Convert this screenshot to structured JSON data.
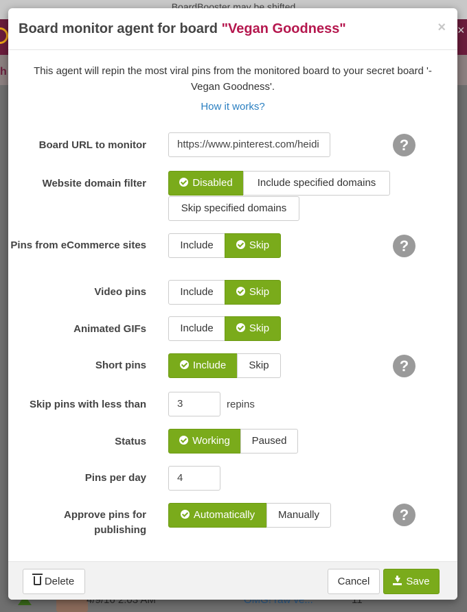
{
  "background": {
    "notice": "BoardBooster may be shifted",
    "header_letter": "h",
    "row_date": "4/9/16 2:03 AM",
    "row_link": "OMG! raw ve...",
    "row_count": "11"
  },
  "modal": {
    "title_prefix": "Board monitor agent for board",
    "board_name": "\"Vegan Goodness\"",
    "close_glyph": "×",
    "intro": "This agent will repin the most viral pins from the monitored board to your secret board '-Vegan Goodness'.",
    "how_link": "How it works?",
    "help_glyph": "?"
  },
  "fields": {
    "board_url": {
      "label": "Board URL to monitor",
      "value": "https://www.pinterest.com/heidi"
    },
    "domain_filter": {
      "label": "Website domain filter",
      "options": [
        "Disabled",
        "Include specified domains",
        "Skip specified domains"
      ],
      "selected": "Disabled"
    },
    "ecommerce": {
      "label": "Pins from eCommerce sites",
      "options": [
        "Include",
        "Skip"
      ],
      "selected": "Skip"
    },
    "video": {
      "label": "Video pins",
      "options": [
        "Include",
        "Skip"
      ],
      "selected": "Skip"
    },
    "gifs": {
      "label": "Animated GIFs",
      "options": [
        "Include",
        "Skip"
      ],
      "selected": "Skip"
    },
    "short": {
      "label": "Short pins",
      "options": [
        "Include",
        "Skip"
      ],
      "selected": "Include"
    },
    "min_repins": {
      "label": "Skip pins with less than",
      "value": "3",
      "unit": "repins"
    },
    "status": {
      "label": "Status",
      "options": [
        "Working",
        "Paused"
      ],
      "selected": "Working"
    },
    "per_day": {
      "label": "Pins per day",
      "value": "4"
    },
    "approve": {
      "label": "Approve pins for publishing",
      "options": [
        "Automatically",
        "Manually"
      ],
      "selected": "Automatically"
    }
  },
  "footer": {
    "delete": "Delete",
    "cancel": "Cancel",
    "save": "Save"
  },
  "colors": {
    "accent_green": "#7aab1b",
    "board_name": "#b5174e",
    "link_blue": "#2a7fc1"
  }
}
